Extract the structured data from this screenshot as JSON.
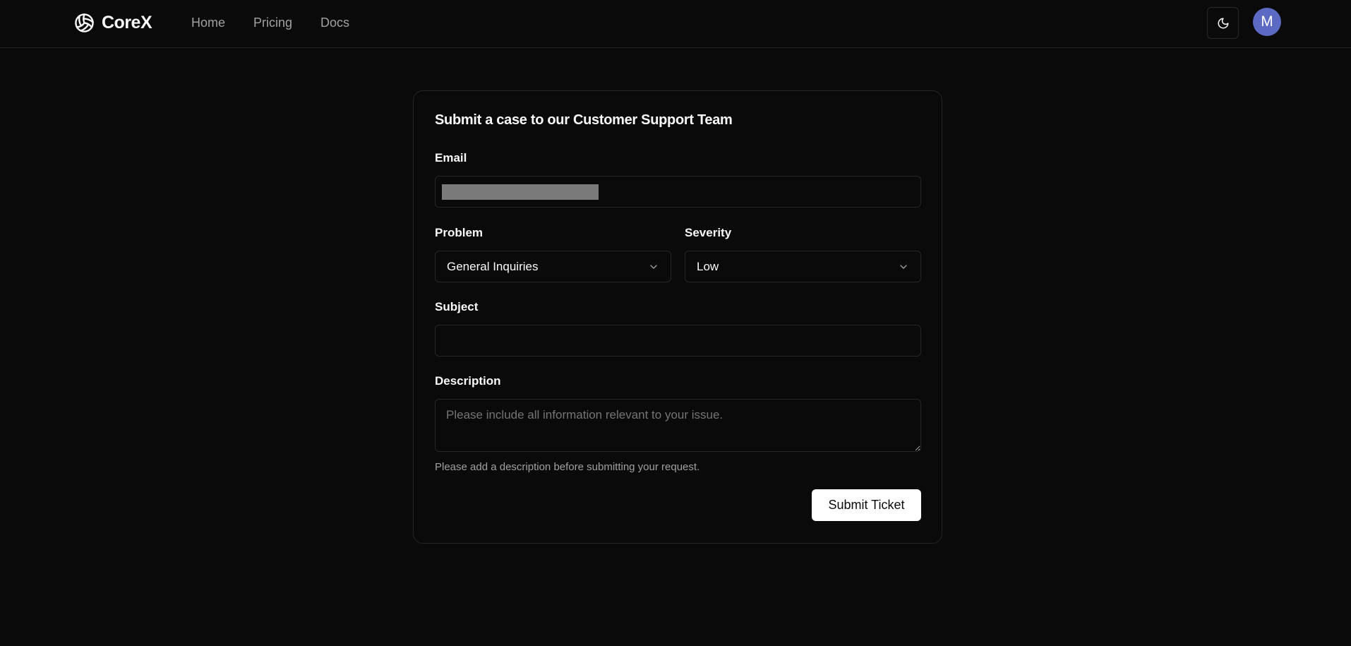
{
  "nav": {
    "brand": "CoreX",
    "links": [
      {
        "label": "Home"
      },
      {
        "label": "Pricing"
      },
      {
        "label": "Docs"
      }
    ],
    "avatar_initial": "M"
  },
  "form": {
    "title": "Submit a case to our Customer Support Team",
    "email": {
      "label": "Email",
      "value": ""
    },
    "problem": {
      "label": "Problem",
      "selected": "General Inquiries"
    },
    "severity": {
      "label": "Severity",
      "selected": "Low"
    },
    "subject": {
      "label": "Subject",
      "value": ""
    },
    "description": {
      "label": "Description",
      "placeholder": "Please include all information relevant to your issue.",
      "helper": "Please add a description before submitting your request."
    },
    "submit_label": "Submit Ticket"
  },
  "colors": {
    "background": "#0a0a0a",
    "border": "#262626",
    "avatar": "#5c6ac4",
    "primary_button": "#ffffff"
  },
  "icons": {
    "logo": "volleyball-icon",
    "theme": "moon-icon",
    "select": "chevron-down-icon"
  }
}
